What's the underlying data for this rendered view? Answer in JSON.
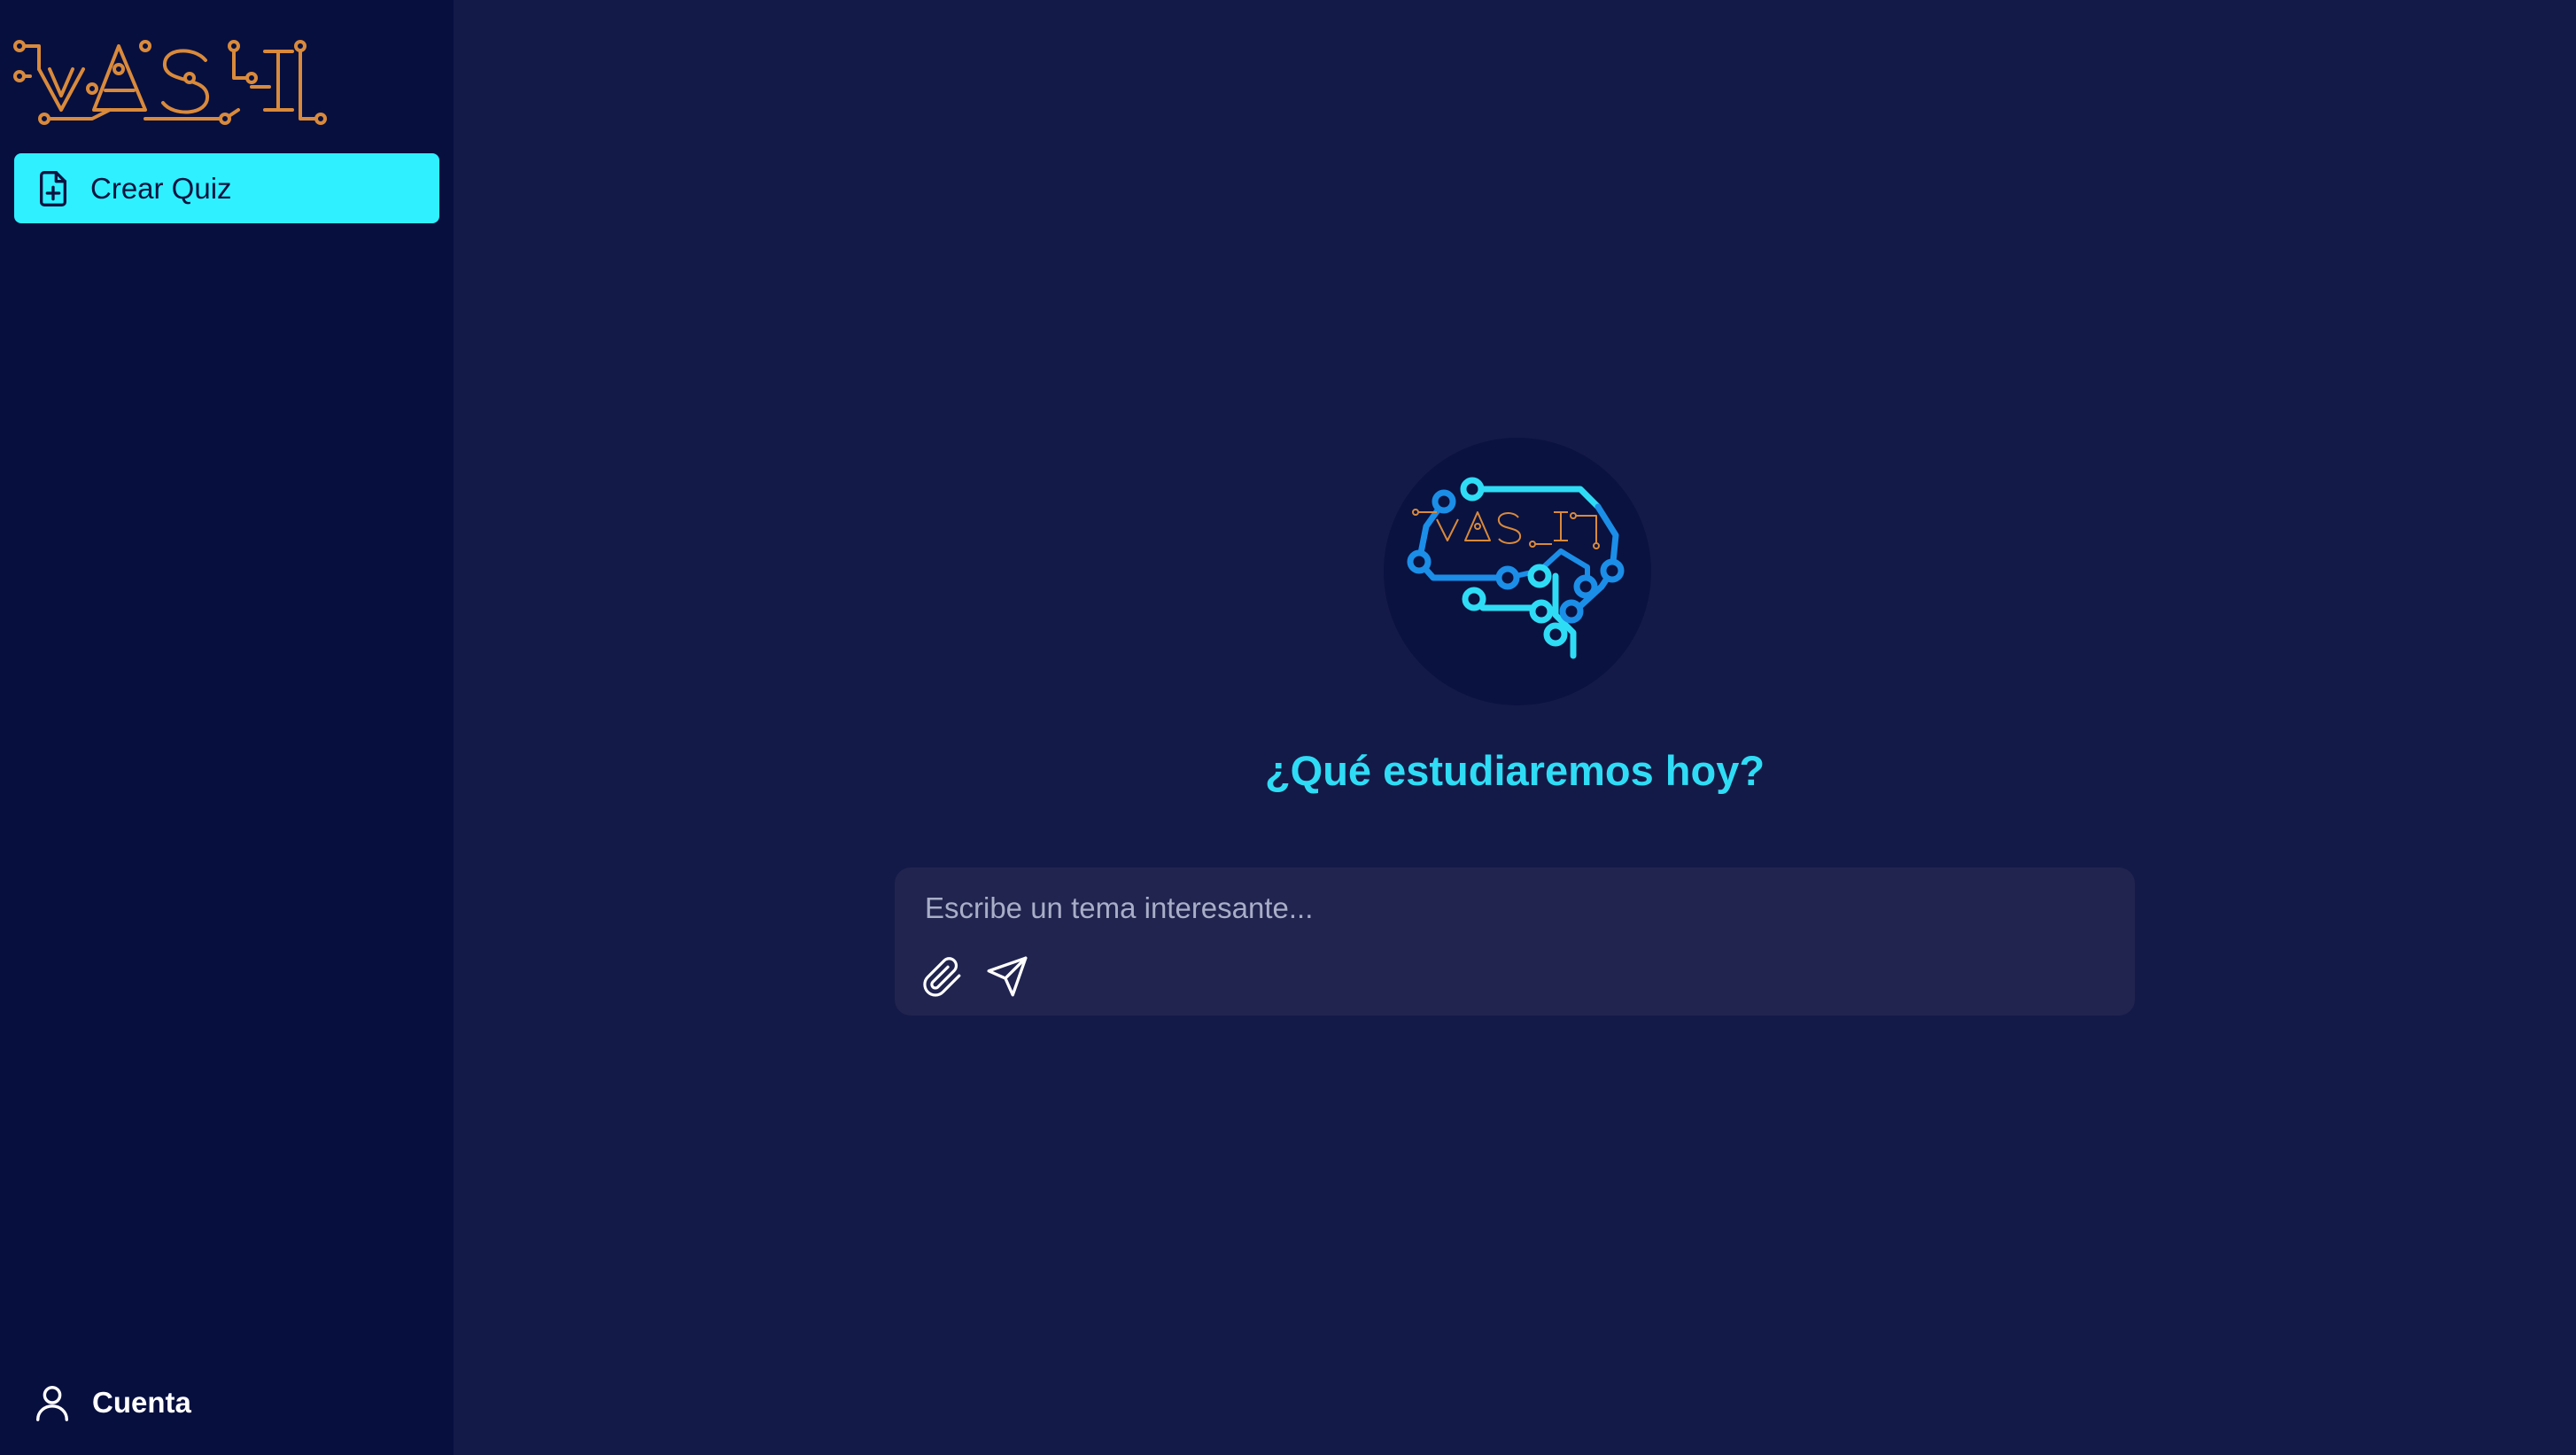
{
  "sidebar": {
    "logo_text": "VASI",
    "new_quiz_label": "Crear Quiz",
    "account_label": "Cuenta"
  },
  "main": {
    "headline": "¿Qué estudiaremos hoy?",
    "composer": {
      "placeholder": "Escribe un tema interesante...",
      "value": ""
    }
  },
  "icons": {
    "new_quiz": "file-plus-icon",
    "account": "user-icon",
    "attach": "paperclip-icon",
    "send": "send-icon"
  },
  "colors": {
    "sidebar_bg": "#070f3f",
    "main_bg": "#141a47",
    "accent_cyan": "#2ff0ff",
    "headline": "#2fdcf5",
    "logo_orange": "#d98a3b",
    "composer_bg": "#20244f"
  }
}
